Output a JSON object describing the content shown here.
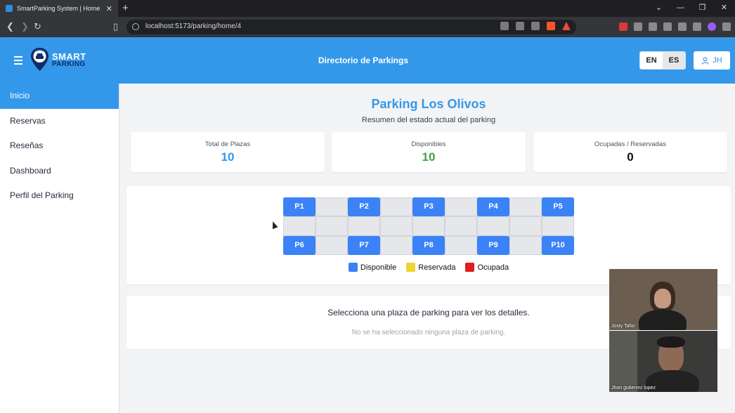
{
  "browser": {
    "tab_title": "SmartParking System | Home",
    "url": "localhost:5173/parking/home/4"
  },
  "header": {
    "logo_line1": "SMART",
    "logo_line2": "PARKING",
    "title": "Directorio de Parkings",
    "lang_en": "EN",
    "lang_es": "ES",
    "user_initials": "JH"
  },
  "sidebar": {
    "items": [
      {
        "label": "Inicio",
        "active": true
      },
      {
        "label": "Reservas"
      },
      {
        "label": "Reseñas"
      },
      {
        "label": "Dashboard"
      },
      {
        "label": "Perfil del Parking"
      }
    ]
  },
  "main": {
    "title": "Parking Los Olivos",
    "subtitle": "Resumen del estado actual del parking",
    "stats": [
      {
        "label": "Total de Plazas",
        "value": "10",
        "color": "#3498ea"
      },
      {
        "label": "Disponibles",
        "value": "10",
        "color": "#43a047"
      },
      {
        "label": "Ocupadas / Reservadas",
        "value": "0",
        "color": "#111111"
      }
    ],
    "slots": [
      "P1",
      "P2",
      "P3",
      "P4",
      "P5",
      "P6",
      "P7",
      "P8",
      "P9",
      "P10"
    ],
    "legend": [
      {
        "label": "Disponible",
        "color": "#3b82f6"
      },
      {
        "label": "Reservada",
        "color": "#ecd534"
      },
      {
        "label": "Ocupada",
        "color": "#e11d1d"
      }
    ],
    "details_heading": "Selecciona una plaza de parking para ver los detalles.",
    "details_empty": "No se ha seleccionado ninguna plaza de parking."
  },
  "video": {
    "participant1": "Josty Tafur",
    "participant2": "Jhon gutierrez lopez"
  }
}
